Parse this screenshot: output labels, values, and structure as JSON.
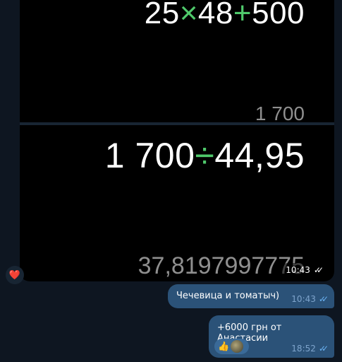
{
  "photos": [
    {
      "expression_parts": [
        "25",
        "×",
        "48",
        "+",
        "500"
      ],
      "result": "1 700"
    },
    {
      "expression_parts": [
        "1 700",
        "÷",
        "44,95"
      ],
      "result": "37,8197997775",
      "time": "10:43"
    }
  ],
  "reaction_heart": "❤️",
  "messages": [
    {
      "text": "Чечевица и томатыч)",
      "time": "10:43"
    },
    {
      "text": "+6000 грн от Анастасии",
      "reaction_emoji": "👍",
      "time": "18:52"
    }
  ],
  "colors": {
    "background": "#0e1621",
    "outgoing_bubble": "#2b5278",
    "operator_green": "#4fc96b",
    "check_blue": "#6ab2f2"
  }
}
